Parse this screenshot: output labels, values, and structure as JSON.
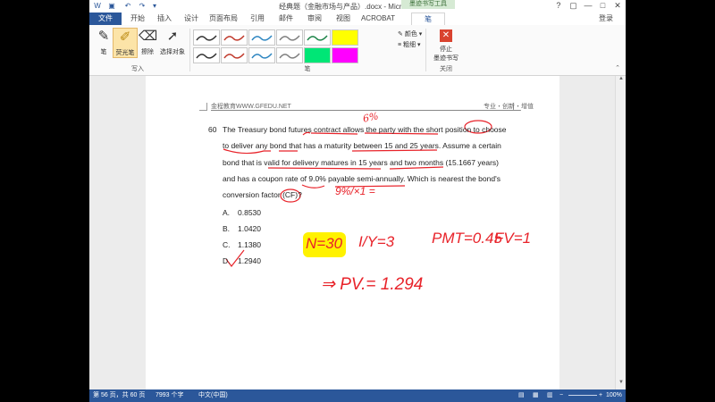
{
  "window": {
    "title": "经典题（金融市场与产品）.docx - Microsoft Word",
    "controls": {
      "help": "?",
      "restore": "▢",
      "minimize": "—",
      "maximize": "□",
      "close": "✕"
    },
    "login": "登录"
  },
  "tabs": {
    "file": "文件",
    "items": [
      "开始",
      "插入",
      "设计",
      "页面布局",
      "引用",
      "邮件",
      "审阅",
      "视图",
      "ACROBAT"
    ],
    "contextual_group": "墨迹书写工具",
    "pen": "笔"
  },
  "ribbon": {
    "write_group": {
      "pen": "笔",
      "highlighter": "荧光笔",
      "eraser": "擦除",
      "select": "选择对象",
      "label": "写入"
    },
    "pens_group": {
      "label": "笔",
      "color": "颜色",
      "thickness": "粗细"
    },
    "close_group": {
      "stop_line1": "停止",
      "stop_line2": "墨迹书写",
      "label": "关闭"
    },
    "pen_colors": [
      "#333333",
      "#c0392b",
      "#2e86c1",
      "#7f7f7f",
      "#1e8449",
      "#ffff00",
      "#333333",
      "#c0392b",
      "#2e86c1",
      "#7f7f7f",
      "#00e676",
      "#ff00ff"
    ]
  },
  "document": {
    "header_left": "金程教育WWW.GFEDU.NET",
    "header_right": "专业・创新・增值",
    "question_number": "60",
    "question_lines": [
      "The Treasury bond futures contract allows the party with the short position to choose",
      "to deliver any bond that has a maturity between 15 and 25 years. Assume a certain",
      "bond that is valid for delivery matures in 15 years and two months (15.1667 years)",
      "and has a coupon rate of 9.0% payable semi-annually. Which is nearest the bond's",
      "conversion factor (CF)?"
    ],
    "options": [
      {
        "letter": "A.",
        "value": "0.8530"
      },
      {
        "letter": "B.",
        "value": "1.0420"
      },
      {
        "letter": "C.",
        "value": "1.1380"
      },
      {
        "letter": "D.",
        "value": "1.2940"
      }
    ],
    "handwriting": {
      "six_percent": "6%",
      "nine_times": "9%/×1 =",
      "n": "N=30",
      "iy": "I/Y=3",
      "pmt": "PMT=0.45",
      "fv": "FV=1",
      "pv": "⇒ PV.= 1.294"
    }
  },
  "status": {
    "page": "第 56 页，共 60 页",
    "words": "7993 个字",
    "language": "中文(中国)",
    "zoom": "100%"
  },
  "colors": {
    "accent": "#2b579a",
    "ink": "#e8232a",
    "highlight": "#fff200"
  }
}
